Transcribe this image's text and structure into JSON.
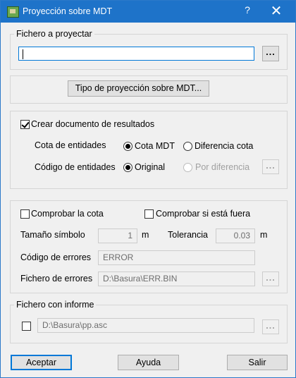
{
  "window": {
    "title": "Proyección sobre MDT",
    "help_label": "?",
    "close_label": "✕"
  },
  "fichero_proyectar": {
    "legend": "Fichero a proyectar",
    "value": "",
    "browse_label": "..."
  },
  "tipo_proyeccion": {
    "button_label": "Tipo de proyección sobre MDT..."
  },
  "resultados": {
    "crear_label": "Crear documento de resultados",
    "crear_checked": true,
    "cota_label": "Cota de entidades",
    "cota_options": [
      "Cota MDT",
      "Diferencia cota"
    ],
    "codigo_label": "Código de entidades",
    "codigo_options": [
      "Original",
      "Por diferencia"
    ],
    "browse_label": "..."
  },
  "errores": {
    "comprobar_cota_label": "Comprobar la cota",
    "comprobar_fuera_label": "Comprobar si está fuera",
    "tamano_label": "Tamaño símbolo",
    "tamano_value": "1",
    "tamano_unit": "m",
    "tolerancia_label": "Tolerancia",
    "tolerancia_value": "0.03",
    "tolerancia_unit": "m",
    "codigo_label": "Código de errores",
    "codigo_value": "ERROR",
    "fichero_label": "Fichero de errores",
    "fichero_value": "D:\\Basura\\ERR.BIN",
    "browse_label": "..."
  },
  "informe": {
    "legend": "Fichero con informe",
    "value": "D:\\Basura\\pp.asc",
    "browse_label": "..."
  },
  "buttons": {
    "aceptar": "Aceptar",
    "ayuda": "Ayuda",
    "salir": "Salir"
  }
}
